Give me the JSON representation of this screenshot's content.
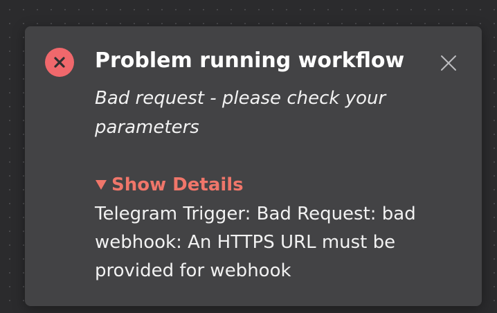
{
  "notification": {
    "title": "Problem running workflow",
    "message": "Bad request - please check your parameters",
    "details_toggle_label": "Show Details",
    "details_text": "Telegram Trigger: Bad Request: bad webhook: An HTTPS URL must be provided for webhook",
    "status": "error",
    "icons": {
      "status": "error-x-icon",
      "close": "close-icon",
      "toggle": "triangle-down-icon"
    }
  },
  "colors": {
    "error_red": "#f0686c",
    "details_accent": "#f0766a",
    "toast_background": "#434345",
    "canvas_background": "#2b2b2d"
  }
}
